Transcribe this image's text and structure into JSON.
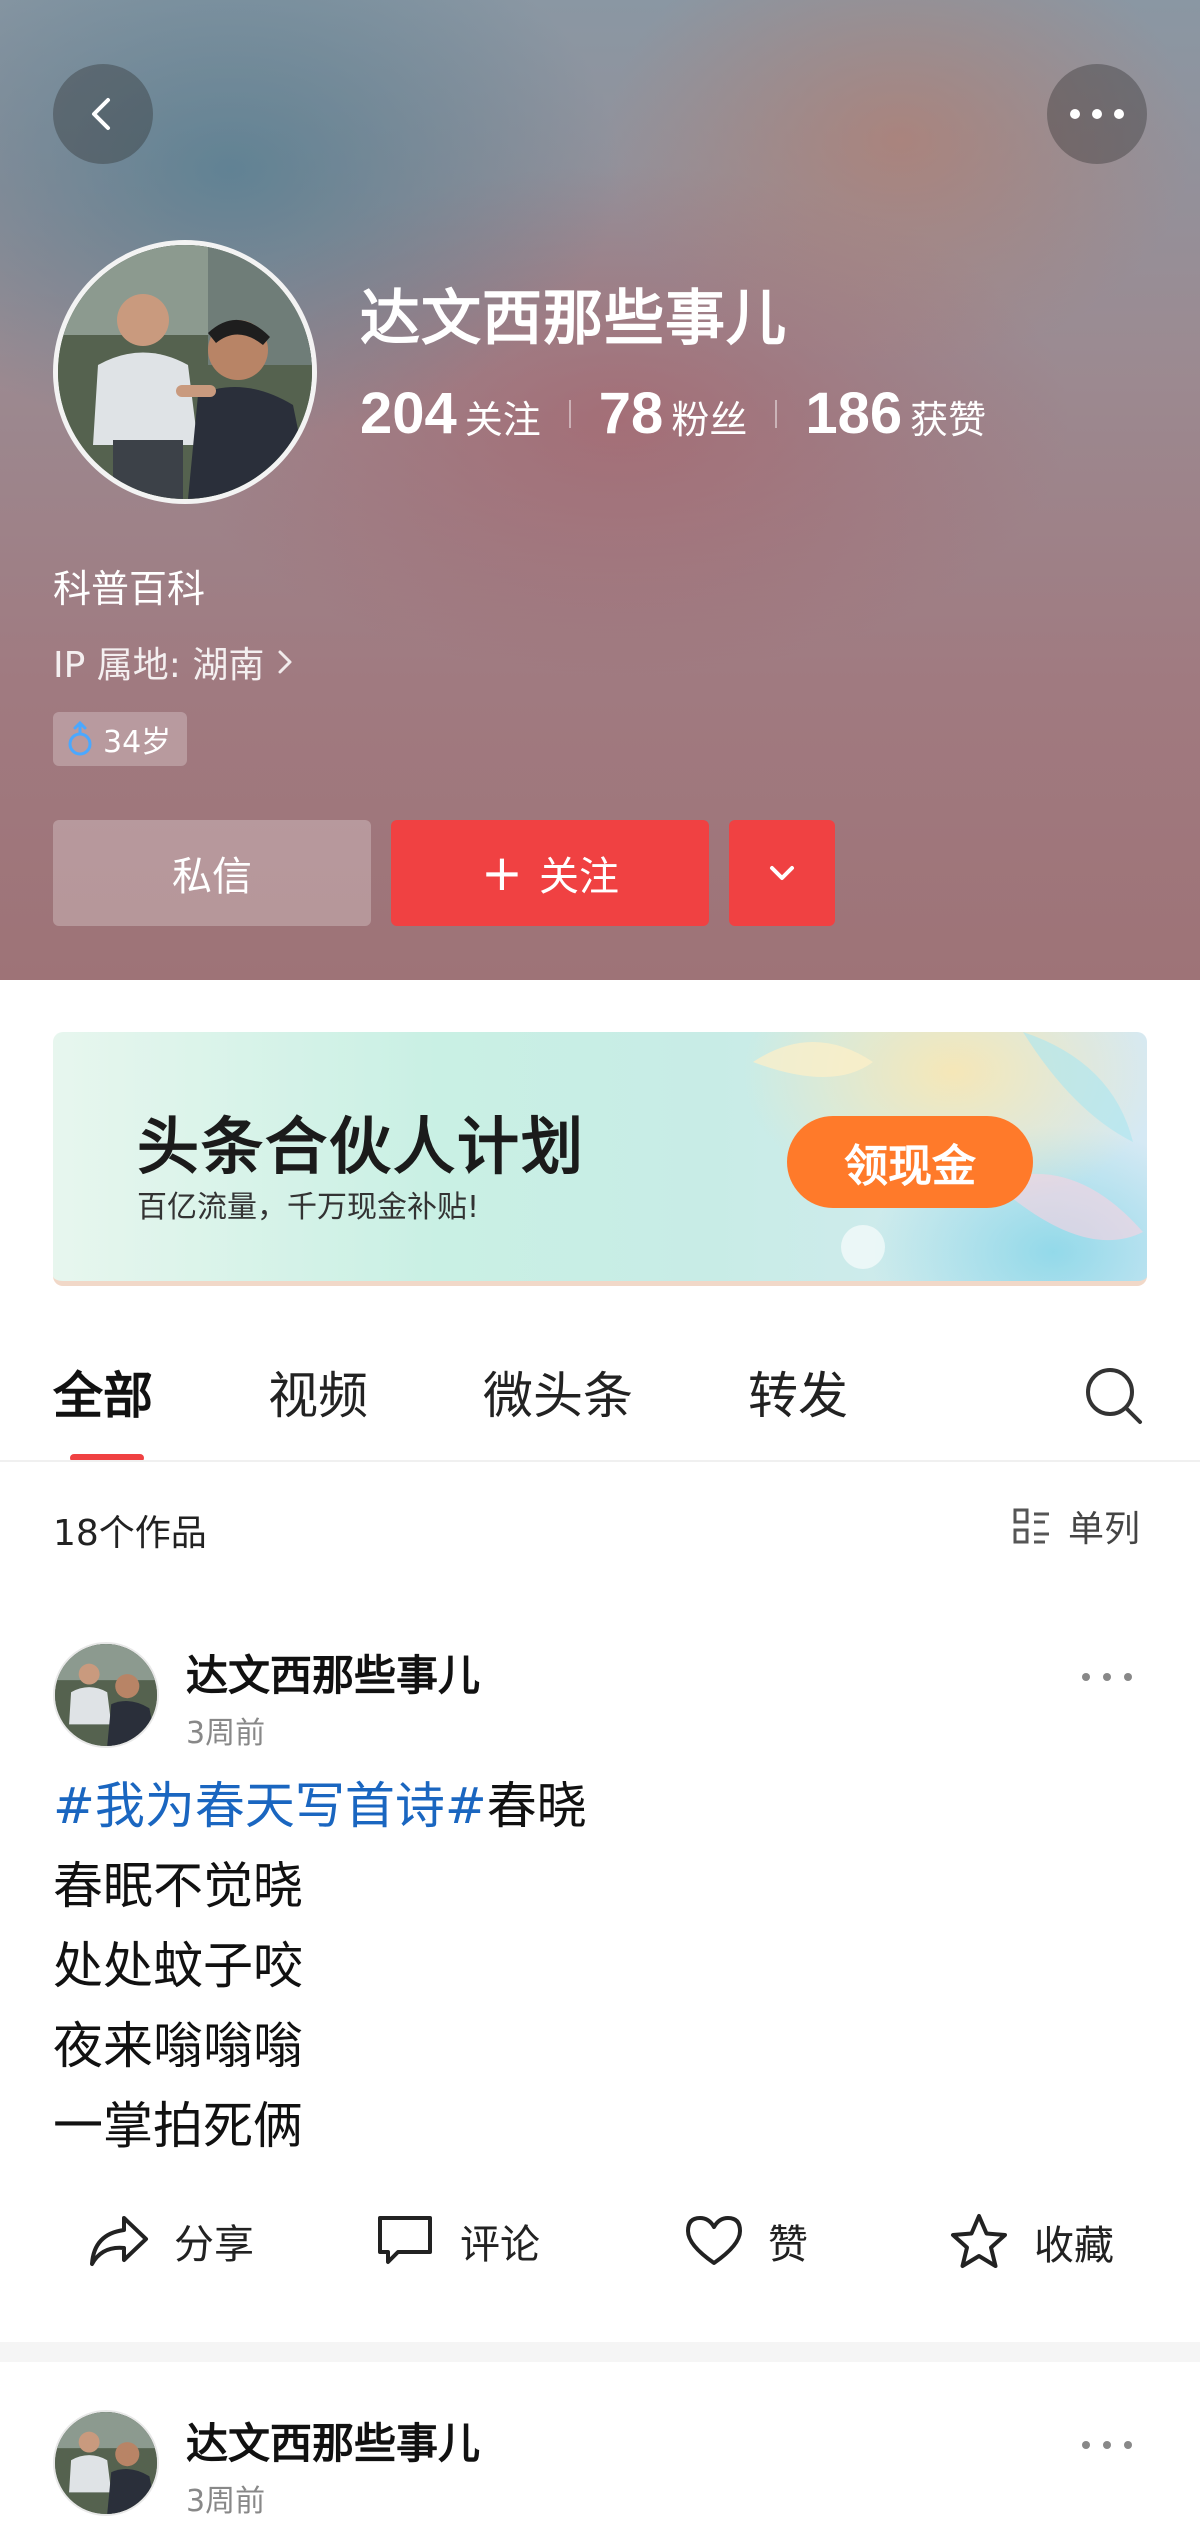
{
  "header": {
    "name": "达文西那些事儿",
    "stats": [
      {
        "num": "204",
        "label": "关注"
      },
      {
        "num": "78",
        "label": "粉丝"
      },
      {
        "num": "186",
        "label": "获赞"
      }
    ],
    "bio": "科普百科",
    "ip_location": "IP 属地: 湖南",
    "age_badge": "34岁",
    "buttons": {
      "message": "私信",
      "follow": "关注",
      "follow_plus": "+"
    }
  },
  "banner": {
    "title": "头条合伙人计划",
    "subtitle": "百亿流量，千万现金补贴!",
    "button": "领现金"
  },
  "tabs": [
    "全部",
    "视频",
    "微头条",
    "转发"
  ],
  "works": {
    "count": "18个作品",
    "layout_label": "单列"
  },
  "posts": [
    {
      "author": "达文西那些事儿",
      "time": "3周前",
      "hashtag": "#我为春天写首诗#",
      "lines": [
        "春晓",
        "春眠不觉晓",
        "处处蚊子咬",
        "夜来嗡嗡嗡",
        "一掌拍死俩"
      ],
      "actions": [
        "分享",
        "评论",
        "赞",
        "收藏"
      ]
    },
    {
      "author": "达文西那些事儿",
      "time": "3周前"
    }
  ],
  "colors": {
    "accent_red": "#f04142",
    "banner_button": "#ff7a2a",
    "hashtag_blue": "#1a66c0"
  },
  "icons": [
    "back-chevron-icon",
    "more-dots-icon",
    "age-badge-icon",
    "chevron-down-icon",
    "search-icon",
    "list-layout-icon",
    "share-icon",
    "comment-icon",
    "like-heart-icon",
    "favorite-star-icon"
  ]
}
